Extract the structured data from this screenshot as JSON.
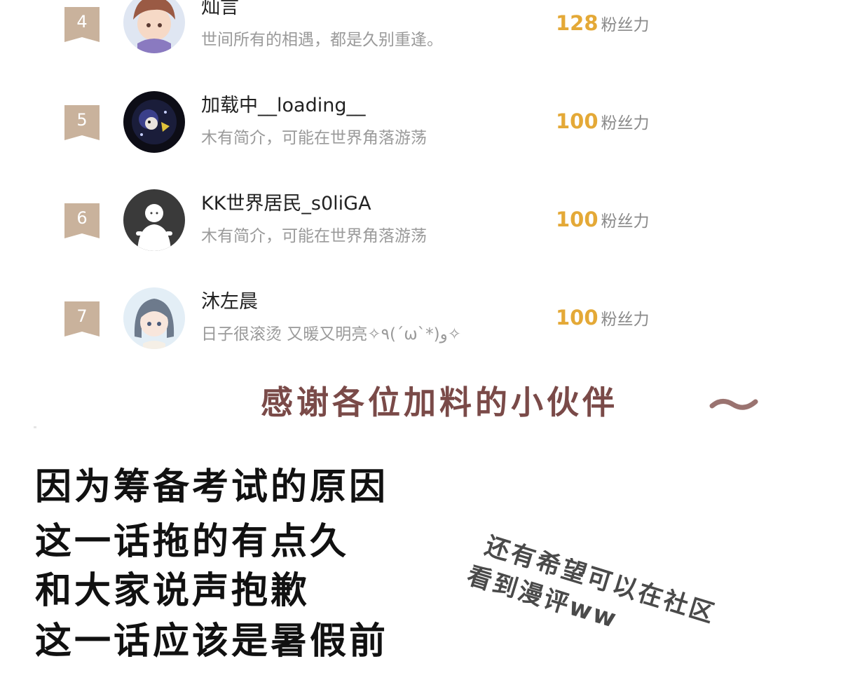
{
  "leaderboard": [
    {
      "rank": "4",
      "name": "灿言",
      "bio": "世间所有的相遇，都是久别重逢。",
      "fans_value": "128",
      "fans_unit": "粉丝力",
      "avatar_icon": "anime-boy-avatar"
    },
    {
      "rank": "5",
      "name": "加载中__loading__",
      "bio": "木有简介，可能在世界角落游荡",
      "fans_value": "100",
      "fans_unit": "粉丝力",
      "avatar_icon": "dark-cosmic-avatar"
    },
    {
      "rank": "6",
      "name": "KK世界居民_s0liGA",
      "bio": "木有简介，可能在世界角落游荡",
      "fans_value": "100",
      "fans_unit": "粉丝力",
      "avatar_icon": "default-person-avatar"
    },
    {
      "rank": "7",
      "name": "沐左晨",
      "bio": "日子很滚烫 又暖又明亮✧٩(ˊωˋ*)و✧",
      "fans_value": "100",
      "fans_unit": "粉丝力",
      "avatar_icon": "anime-girl-avatar"
    }
  ],
  "thanks_text": "感谢各位加料的小伙伴",
  "note_lines": [
    "因为筹备考试的原因",
    "这一话拖的有点久",
    "和大家说声抱歉",
    "这一话应该是暑假前"
  ],
  "side_note_lines": [
    "还有希望可以在社区",
    "看到漫评ww"
  ],
  "colors": {
    "badge": "#c9b29c",
    "fans_value": "#e4a937",
    "thanks_text": "#7a4a48",
    "bio_text": "#9a9a9a"
  }
}
